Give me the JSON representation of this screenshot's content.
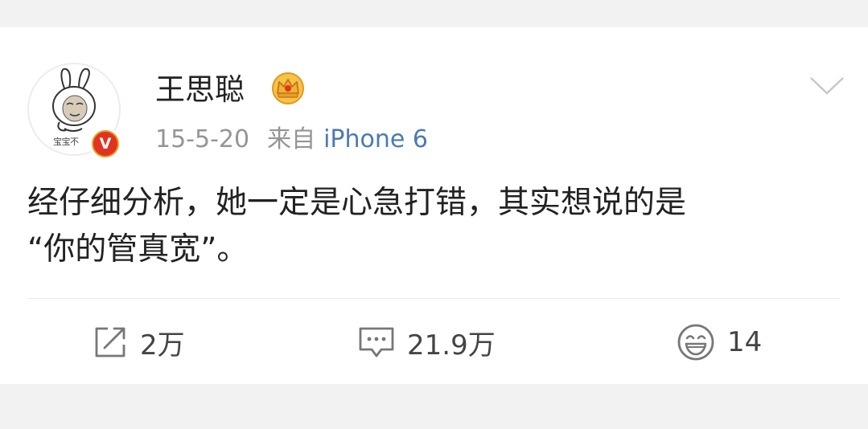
{
  "post": {
    "author": {
      "name": "王思聪",
      "avatar_caption": "宝宝不",
      "verified_badge": "V",
      "member_icon": "crown-icon"
    },
    "meta": {
      "time": "15-5-20",
      "from_label": "来自",
      "device": "iPhone 6"
    },
    "content": "经仔细分析，她一定是心急打错，其实想说的是\n“你的管真宽”。",
    "actions": {
      "repost": {
        "icon": "repost-icon",
        "count": "2万"
      },
      "comment": {
        "icon": "comment-icon",
        "count": "21.9万"
      },
      "like": {
        "icon": "smile-icon",
        "count": "14"
      }
    }
  },
  "colors": {
    "link": "#4b7ab5",
    "verified": "#e0341f",
    "crown": "#f2b233",
    "background": "#f2f2f2"
  }
}
